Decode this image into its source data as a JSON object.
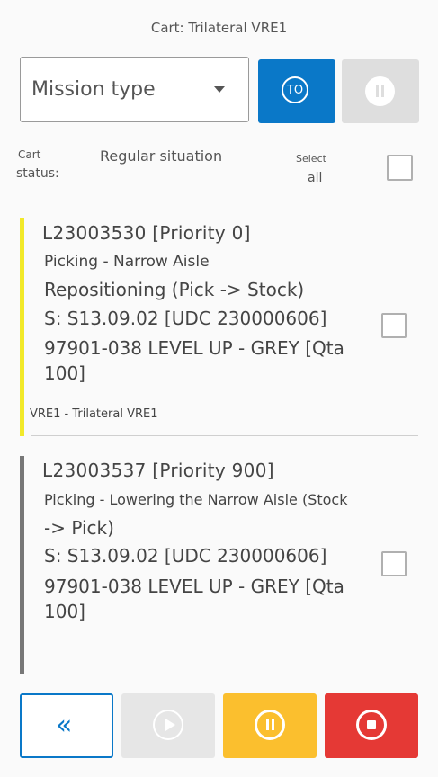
{
  "header": {
    "cart_title": "Cart: Trilateral VRE1"
  },
  "controls": {
    "mission_type_label": "Mission type",
    "to_button_label": "TO"
  },
  "status": {
    "cart_status_label_1": "Cart",
    "cart_status_label_2": "status:",
    "cart_status_value": "Regular situation",
    "select_all_label_1": "Select",
    "select_all_label_2": "all",
    "select_all_checked": false
  },
  "missions": [
    {
      "title": "L23003530 [Priority 0]",
      "type": "Picking - Narrow Aisle",
      "operation": "Repositioning (Pick -> Stock)",
      "source": "S: S13.09.02 [UDC 230000606]",
      "item_line1": "97901-038 LEVEL UP - GREY [Qta",
      "item_line2": "100]",
      "cart": "VRE1 - Trilateral VRE1",
      "bar_color": "#f2e92a",
      "checked": false
    },
    {
      "title": "L23003537 [Priority 900]",
      "type": "Picking - Lowering the Narrow Aisle (Stock",
      "operation": "-> Pick)",
      "source": "S: S13.09.02 [UDC 230000606]",
      "item_line1": "97901-038 LEVEL UP - GREY [Qta",
      "item_line2": "100]",
      "bar_color": "#777777",
      "checked": false
    }
  ],
  "icons": {
    "back": "chevron-double-left-icon",
    "play": "play-circle-icon",
    "pause": "pause-circle-icon",
    "stop": "stop-circle-icon"
  },
  "colors": {
    "primary": "#0a78c8",
    "pause": "#fbbf2e",
    "stop": "#e53935",
    "disabled": "#dedede"
  }
}
